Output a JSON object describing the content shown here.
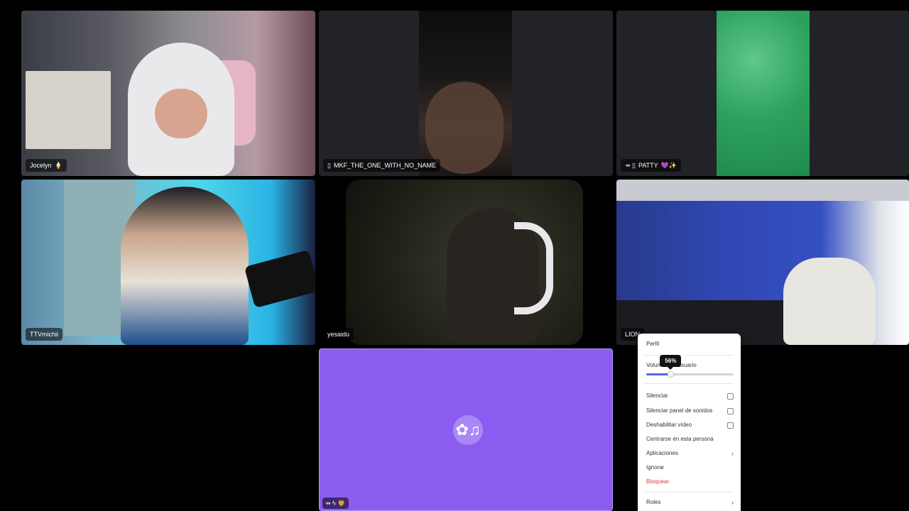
{
  "tiles": [
    {
      "name": "Jocelyn",
      "icons": [
        "ice-cream-icon"
      ],
      "emoji": "🍦"
    },
    {
      "name": "MKF_THE_ONE_WITH_NO_NAME",
      "icons": [
        "mobile-icon"
      ],
      "prefix": "▯"
    },
    {
      "name": "PATTY",
      "icons": [
        "muted-icon",
        "mobile-icon",
        "heart-icon",
        "sparkles-icon"
      ],
      "prefix": "⇸ ▯",
      "suffix": "💜✨"
    },
    {
      "name": "TTVmichii"
    },
    {
      "name": "yesaidu"
    },
    {
      "name": "LION"
    },
    {
      "name": "",
      "activity_badges": "⇸ ϟ 🦁",
      "activity_logo": "✿♫"
    }
  ],
  "context_menu": {
    "profile": "Perfil",
    "user_volume_label": "Volumen de usuario",
    "volume_tooltip": "56%",
    "volume_fraction": 0.28,
    "mute": "Silenciar",
    "mute_soundboard": "Silenciar panel de sonidos",
    "disable_video": "Deshabilitar vídeo",
    "focus_person": "Centrarse en esta persona",
    "apps": "Aplicaciones",
    "ignore": "Ignorar",
    "block": "Bloquear",
    "roles": "Roles"
  },
  "colors": {
    "accent": "#5865f2",
    "danger": "#da373c",
    "activity_bg": "#8c5cf0"
  }
}
